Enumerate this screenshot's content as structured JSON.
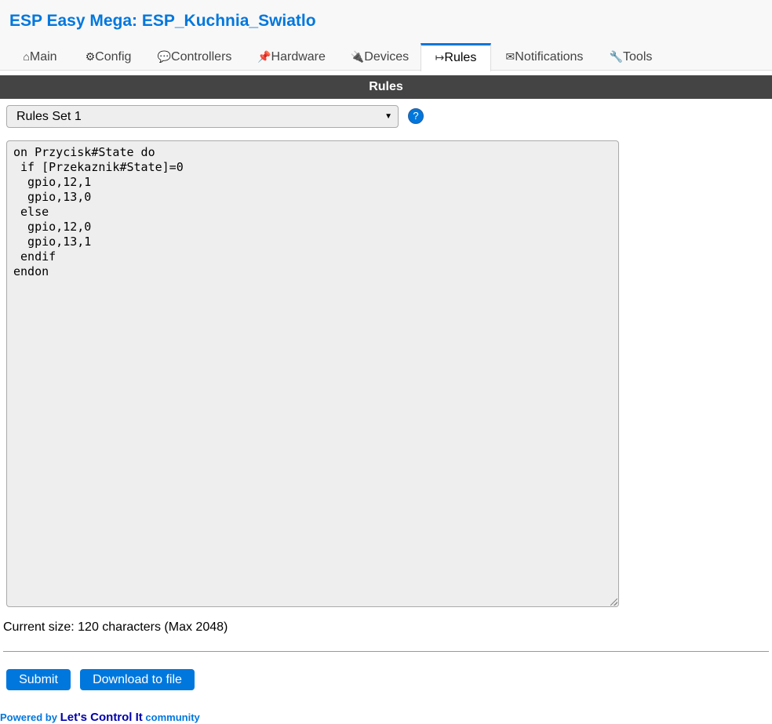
{
  "header": {
    "title": "ESP Easy Mega: ESP_Kuchnia_Swiatlo"
  },
  "tabs": [
    {
      "icon": "⌂",
      "label": "Main"
    },
    {
      "icon": "⚙",
      "label": "Config"
    },
    {
      "icon": "💬",
      "label": "Controllers"
    },
    {
      "icon": "📌",
      "label": "Hardware"
    },
    {
      "icon": "🔌",
      "label": "Devices"
    },
    {
      "icon": "↦",
      "label": "Rules",
      "active": true
    },
    {
      "icon": "✉",
      "label": "Notifications"
    },
    {
      "icon": "🔧",
      "label": "Tools"
    }
  ],
  "section": {
    "title": "Rules"
  },
  "rules_select": {
    "selected": "Rules Set 1",
    "help_glyph": "?"
  },
  "editor": {
    "content": "on Przycisk#State do\n if [Przekaznik#State]=0\n  gpio,12,1\n  gpio,13,0\n else\n  gpio,12,0\n  gpio,13,1\n endif\nendon"
  },
  "status": {
    "size_text": "Current size: 120 characters (Max 2048)"
  },
  "buttons": {
    "submit": "Submit",
    "download": "Download to file"
  },
  "footer": {
    "prefix": "Powered by ",
    "link": "Let's Control It",
    "suffix": " community"
  },
  "colors": {
    "accent": "#0077dd",
    "section_bar": "#444444",
    "editor_bg": "#eeeeee"
  }
}
